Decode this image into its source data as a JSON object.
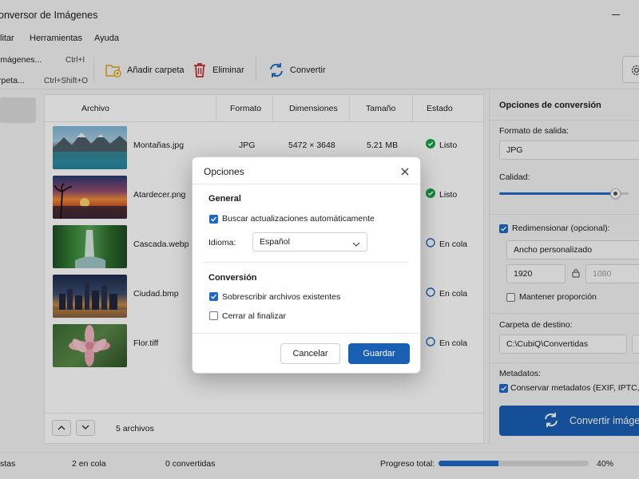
{
  "app": {
    "title": "onversor de Imágenes"
  },
  "menu": {
    "items": [
      "litar",
      "Herramientas",
      "Ayuda"
    ]
  },
  "file_menu": {
    "items": [
      {
        "label": "imágenes...",
        "shortcut": "Ctrl+I"
      },
      {
        "label": "rpeta...",
        "shortcut": "Ctrl+Shift+O"
      }
    ]
  },
  "toolbar": {
    "add_folder": "Añadir carpeta",
    "delete": "Eliminar",
    "convert": "Convertir"
  },
  "table": {
    "headers": [
      "Archivo",
      "Formato",
      "Dimensiones",
      "Tamaño",
      "Estado"
    ],
    "rows": [
      {
        "name": "Montañas.jpg",
        "format": "JPG",
        "dimensions": "5472 × 3648",
        "size": "5.21 MB",
        "status": "Listo",
        "state": "done",
        "thumb": "mountains"
      },
      {
        "name": "Atardecer.png",
        "format": "",
        "dimensions": "",
        "size": "",
        "status": "Listo",
        "state": "done",
        "thumb": "sunset"
      },
      {
        "name": "Cascada.webp",
        "format": "",
        "dimensions": "",
        "size": "",
        "status": "En cola",
        "state": "queued",
        "thumb": "waterfall"
      },
      {
        "name": "Ciudad.bmp",
        "format": "",
        "dimensions": "",
        "size": "",
        "status": "En cola",
        "state": "queued",
        "thumb": "city"
      },
      {
        "name": "Flor.tiff",
        "format": "",
        "dimensions": "",
        "size": "",
        "status": "En cola",
        "state": "queued",
        "thumb": "flower"
      }
    ],
    "count_label": "5 archivos"
  },
  "options_panel": {
    "title": "Opciones de conversión",
    "output_format_label": "Formato de salida:",
    "output_format_value": "JPG",
    "quality_label": "Calidad:",
    "quality_fraction": 0.9,
    "resize_label": "Redimensionar (opcional):",
    "resize_checked": true,
    "resize_mode": "Ancho personalizado",
    "width": "1920",
    "height": "1080",
    "keep_ratio_label": "Mantener proporción",
    "keep_ratio_checked": false,
    "dest_label": "Carpeta de destino:",
    "dest_value": "C:\\CubiQ\\Convertidas",
    "metadata_label": "Metadatos:",
    "metadata_option": "Conservar metadatos (EXIF, IPTC, XMP)",
    "metadata_checked": true,
    "convert_button": "Convertir imágenes"
  },
  "statusbar": {
    "ready": "stas",
    "queued": "2 en cola",
    "converted": "0 convertidas",
    "progress_label": "Progreso total:",
    "progress_text": "40%",
    "progress_fraction": 0.4
  },
  "dialog": {
    "title": "Opciones",
    "general_section": "General",
    "auto_update_label": "Buscar actualizaciones automáticamente",
    "auto_update_checked": true,
    "language_label": "Idioma:",
    "language_value": "Español",
    "conversion_section": "Conversión",
    "overwrite_label": "Sobrescribir archivos existentes",
    "overwrite_checked": true,
    "close_on_finish_label": "Cerrar al finalizar",
    "close_on_finish_checked": false,
    "cancel_button": "Cancelar",
    "save_button": "Guardar"
  },
  "colors": {
    "accent": "#1a5fb4",
    "check": "#1f68c6",
    "done": "#16a34a",
    "queued": "#1f68c6",
    "folder": "#e0a41d",
    "delete": "#c62828"
  }
}
